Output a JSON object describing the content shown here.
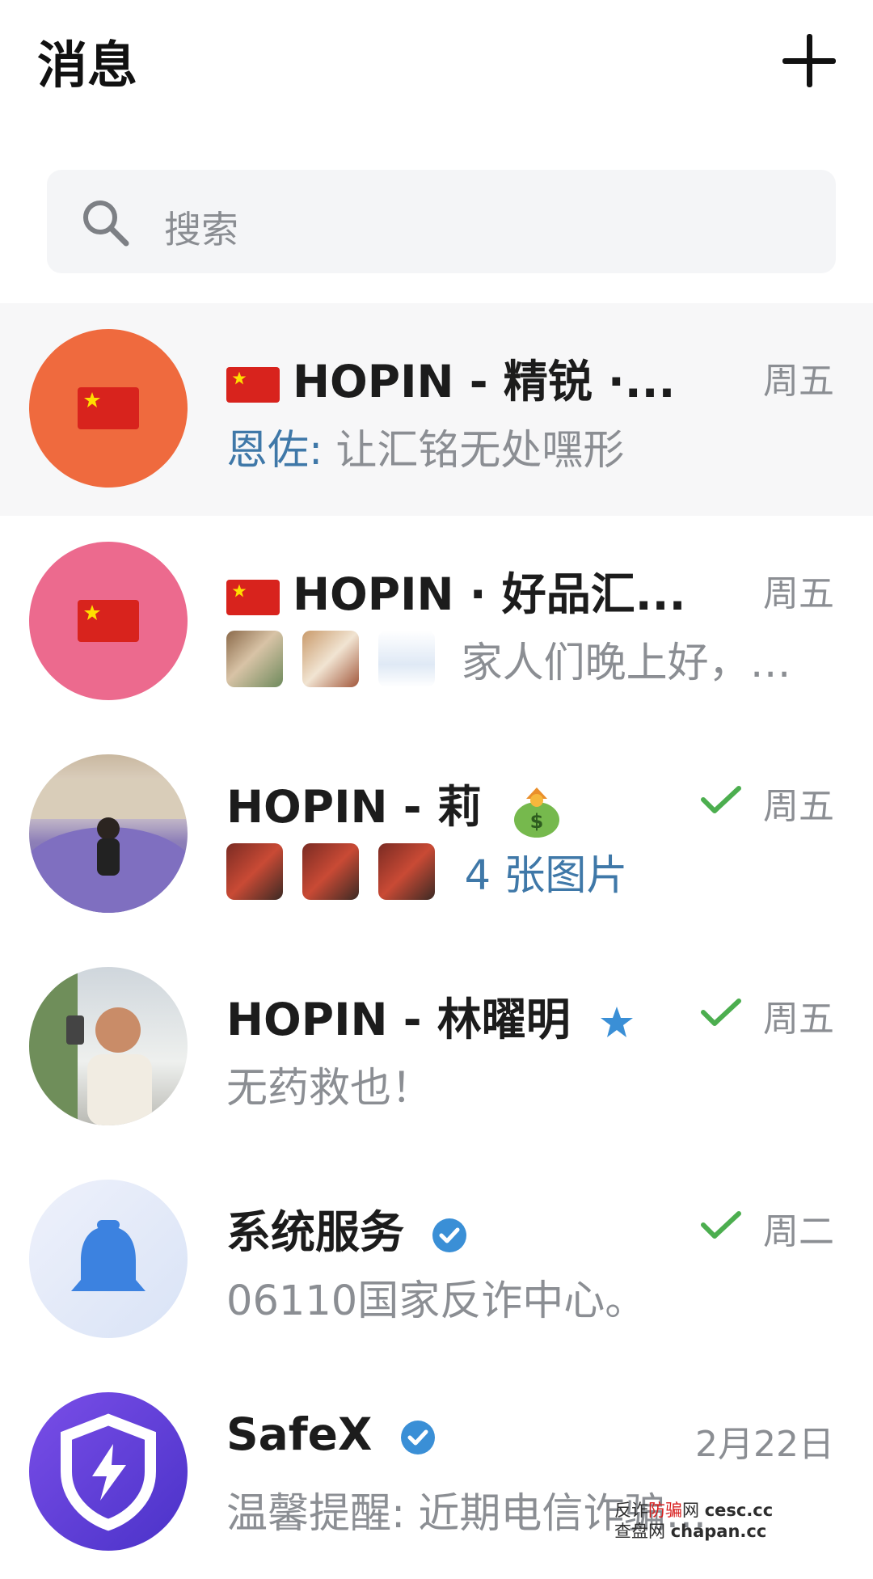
{
  "header": {
    "title": "消息",
    "add_icon": "plus-icon"
  },
  "search": {
    "placeholder": "搜索",
    "icon": "search-icon"
  },
  "conversations": [
    {
      "name": "HOPIN - 精锐 ·...",
      "time": "周五",
      "sender": "恩佐:",
      "message": "让汇铭无处嘿形",
      "avatar_color": "#ef6a3e",
      "avatar_icon": "china-flag-icon"
    },
    {
      "name": "HOPIN · 好品汇...",
      "time": "周五",
      "message": "家人们晚上好，…",
      "avatar_color": "#ec6a8e",
      "avatar_icon": "china-flag-icon"
    },
    {
      "name": "HOPIN - 莉",
      "time": "周五",
      "message": "4 张图片",
      "read": true,
      "avatar_icon": "photo-avatar"
    },
    {
      "name": "HOPIN - 林曜明",
      "time": "周五",
      "message": "无药救也！",
      "read": true,
      "avatar_icon": "photo-avatar"
    },
    {
      "name": "系统服务",
      "time": "周二",
      "message": "06110国家反诈中心。",
      "read": true,
      "avatar_icon": "bell-icon"
    },
    {
      "name": "SafeX",
      "time": "2月22日",
      "message": "温馨提醒: 近期电信诈骗…",
      "avatar_icon": "shield-bolt-icon"
    }
  ],
  "watermark": {
    "line1_a": "反诈",
    "line1_b": "防骗",
    "line1_c": "网",
    "line1_url": "cesc.cc",
    "line2_a": "查盘网",
    "line2_url": "chapan.cc"
  },
  "colors": {
    "accent": "#3f78a8",
    "check": "#4cae4f",
    "verified": "#3a8fd6"
  }
}
